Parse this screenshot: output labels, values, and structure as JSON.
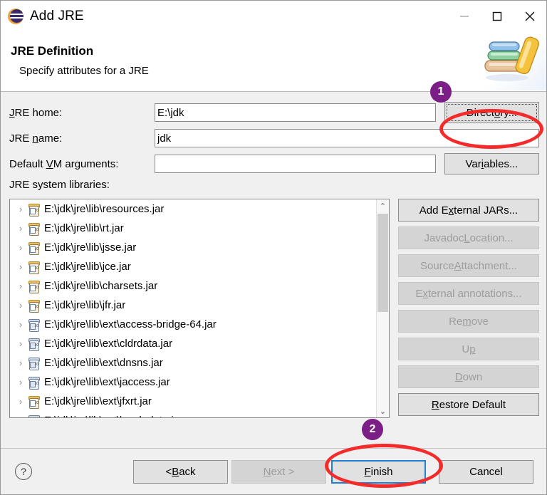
{
  "window": {
    "title": "Add JRE",
    "icon": "eclipse-icon",
    "controls": {
      "minimize": "minimize-icon",
      "maximize": "maximize-icon",
      "close": "close-icon"
    }
  },
  "header": {
    "title": "JRE Definition",
    "subtitle": "Specify attributes for a JRE",
    "banner_icon": "books-icon"
  },
  "form": {
    "jre_home": {
      "label_pre": "",
      "label_mnemonic": "J",
      "label_post": "RE home:",
      "value": "E:\\jdk"
    },
    "jre_name": {
      "label_pre": "JRE ",
      "label_mnemonic": "n",
      "label_post": "ame:",
      "value": "jdk"
    },
    "vm_args": {
      "label_pre": "Default ",
      "label_mnemonic": "V",
      "label_post": "M arguments:",
      "value": "",
      "placeholder": ""
    },
    "directory_button": {
      "pre": "Direct",
      "mnemonic": "o",
      "post": "ry..."
    },
    "variables_button": {
      "pre": "Var",
      "mnemonic": "i",
      "post": "ables..."
    }
  },
  "libraries": {
    "label": "JRE system libraries:",
    "items": [
      {
        "path": "E:\\jdk\\jre\\lib\\resources.jar",
        "icon": "jar-icon",
        "ext": false
      },
      {
        "path": "E:\\jdk\\jre\\lib\\rt.jar",
        "icon": "jar-icon",
        "ext": false
      },
      {
        "path": "E:\\jdk\\jre\\lib\\jsse.jar",
        "icon": "jar-icon",
        "ext": false
      },
      {
        "path": "E:\\jdk\\jre\\lib\\jce.jar",
        "icon": "jar-icon",
        "ext": false
      },
      {
        "path": "E:\\jdk\\jre\\lib\\charsets.jar",
        "icon": "jar-icon",
        "ext": false
      },
      {
        "path": "E:\\jdk\\jre\\lib\\jfr.jar",
        "icon": "jar-icon",
        "ext": false
      },
      {
        "path": "E:\\jdk\\jre\\lib\\ext\\access-bridge-64.jar",
        "icon": "jar-icon",
        "ext": true
      },
      {
        "path": "E:\\jdk\\jre\\lib\\ext\\cldrdata.jar",
        "icon": "jar-icon",
        "ext": true
      },
      {
        "path": "E:\\jdk\\jre\\lib\\ext\\dnsns.jar",
        "icon": "jar-icon",
        "ext": true
      },
      {
        "path": "E:\\jdk\\jre\\lib\\ext\\jaccess.jar",
        "icon": "jar-icon",
        "ext": true
      },
      {
        "path": "E:\\jdk\\jre\\lib\\ext\\jfxrt.jar",
        "icon": "jar-icon",
        "ext": false
      },
      {
        "path": "E:\\jdk\\jre\\lib\\ext\\localedata.jar",
        "icon": "jar-icon",
        "ext": true
      }
    ],
    "expander_glyph": "›",
    "scrollbar": {
      "up_glyph": "⌃",
      "down_glyph": "⌄"
    }
  },
  "side_buttons": [
    {
      "pre": "Add E",
      "mnemonic": "x",
      "post": "ternal JARs...",
      "disabled": false
    },
    {
      "pre": "Javadoc ",
      "mnemonic": "L",
      "post": "ocation...",
      "disabled": true
    },
    {
      "pre": "Source ",
      "mnemonic": "A",
      "post": "ttachment...",
      "disabled": true
    },
    {
      "pre": "E",
      "mnemonic": "x",
      "post": "ternal annotations...",
      "disabled": true
    },
    {
      "pre": "Re",
      "mnemonic": "m",
      "post": "ove",
      "disabled": true
    },
    {
      "pre": "U",
      "mnemonic": "p",
      "post": "",
      "disabled": true
    },
    {
      "pre": "",
      "mnemonic": "D",
      "post": "own",
      "disabled": true
    },
    {
      "pre": "",
      "mnemonic": "R",
      "post": "estore Default",
      "disabled": false
    }
  ],
  "footer": {
    "help_icon": "help-icon",
    "back": {
      "pre": "< ",
      "mnemonic": "B",
      "post": "ack",
      "disabled": false
    },
    "next": {
      "pre": "",
      "mnemonic": "N",
      "post": "ext >",
      "disabled": true
    },
    "finish": {
      "pre": "",
      "mnemonic": "F",
      "post": "inish",
      "disabled": false,
      "default": true
    },
    "cancel": {
      "pre": "Cancel",
      "mnemonic": "",
      "post": "",
      "disabled": false
    }
  },
  "annotations": {
    "badge1": "1",
    "badge2": "2",
    "badge_color": "#7b1f86",
    "highlight_color": "#f42b2b"
  }
}
